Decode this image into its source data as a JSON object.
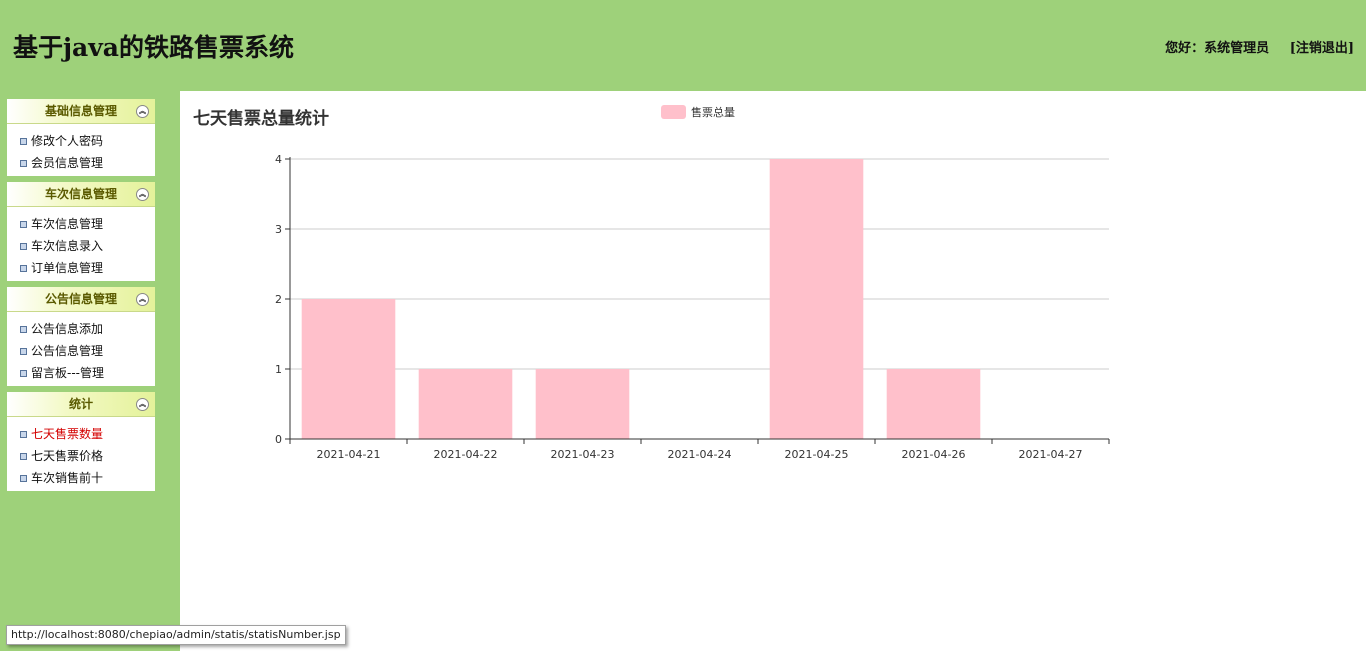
{
  "header": {
    "title": "基于java的铁路售票系统",
    "greeting": "您好：系统管理员",
    "logout": "[注销退出]"
  },
  "sidebar": {
    "panels": [
      {
        "title": "基础信息管理",
        "collapse_icon": "double-chevron-up-icon",
        "items": [
          "修改个人密码",
          "会员信息管理"
        ]
      },
      {
        "title": "车次信息管理",
        "collapse_icon": "double-chevron-up-icon",
        "items": [
          "车次信息管理",
          "车次信息录入",
          "订单信息管理"
        ]
      },
      {
        "title": "公告信息管理",
        "collapse_icon": "double-chevron-up-icon",
        "items": [
          "公告信息添加",
          "公告信息管理",
          "留言板---管理"
        ]
      },
      {
        "title": "统计",
        "collapse_icon": "double-chevron-up-icon",
        "items": [
          "七天售票数量",
          "七天售票价格",
          "车次销售前十"
        ],
        "active_index": 0
      }
    ]
  },
  "chart_data": {
    "type": "bar",
    "title": "七天售票总量统计",
    "categories": [
      "2021-04-21",
      "2021-04-22",
      "2021-04-23",
      "2021-04-24",
      "2021-04-25",
      "2021-04-26",
      "2021-04-27"
    ],
    "series": [
      {
        "name": "售票总量",
        "values": [
          2,
          1,
          1,
          0,
          4,
          1,
          0
        ],
        "color": "#ffc0cb"
      }
    ],
    "ylim": [
      0,
      4
    ],
    "yticks": [
      0,
      1,
      2,
      3,
      4
    ],
    "grid": true,
    "legend_position": "top-center"
  },
  "statusbar": {
    "url": "http://localhost:8080/chepiao/admin/statis/statisNumber.jsp"
  },
  "colors": {
    "header_bg": "#9ed17a",
    "bar": "#ffc0cb",
    "active_item": "#d40000"
  }
}
